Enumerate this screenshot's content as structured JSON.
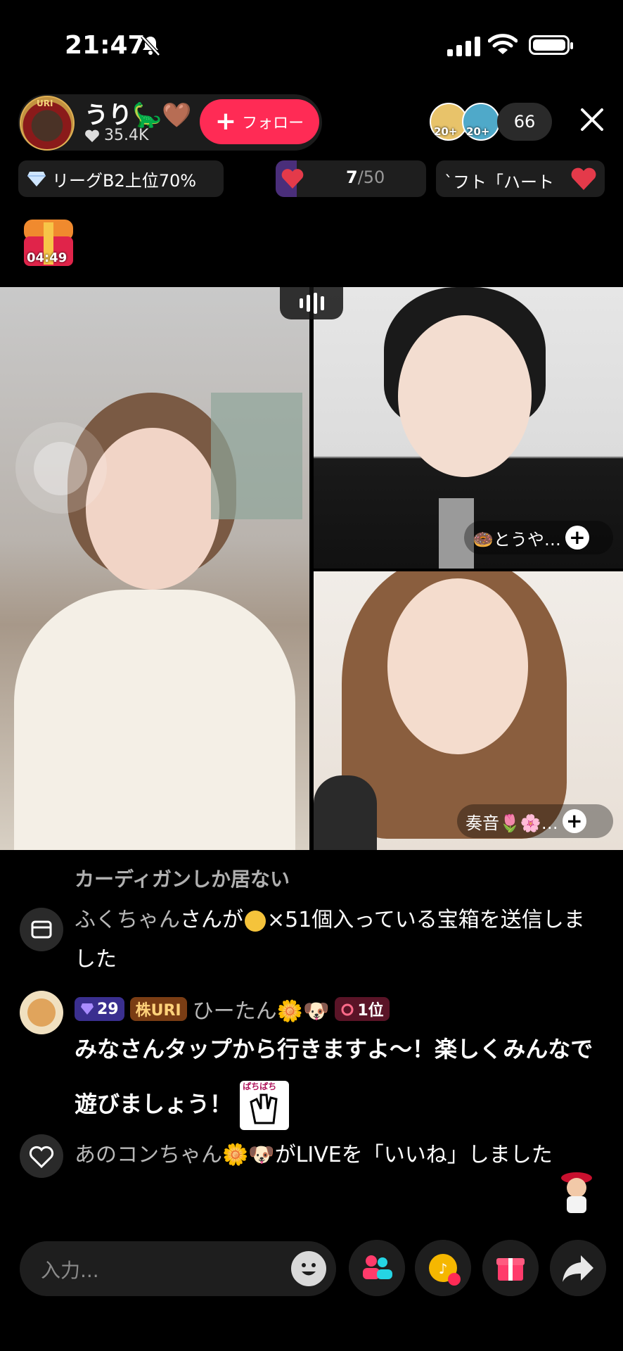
{
  "status_bar": {
    "time": "21:47"
  },
  "host": {
    "avatar_text": "URI",
    "name": "うり🦕🤎",
    "likes": "35.4K",
    "follow_label": "フォロー"
  },
  "viewers": {
    "badge_1": "20+",
    "badge_2": "20+",
    "count": "66"
  },
  "league": {
    "label": "リーグB2上位70%"
  },
  "goal": {
    "current": "7",
    "max": "/50",
    "progress": 0.14
  },
  "gift_ticker": {
    "text": "`フト「ハート"
  },
  "chest": {
    "timer": "04:49"
  },
  "guests": [
    {
      "name": "🍩とうや…"
    },
    {
      "name": "奏音🌷🌸…"
    }
  ],
  "chat": [
    {
      "text": "カーディガンしか居ない"
    },
    {
      "user": "ふくちゃん",
      "pre": "さんが",
      "mid": "×51個入っている宝箱を送信しました"
    },
    {
      "badge_level": "29",
      "badge_fan": "株URI",
      "user": "ひーたん🌼🐶",
      "rank": "1位",
      "text": "みなさんタップから行きますよ〜！楽しくみんなで遊びましょう！",
      "sticker_text": "ぱちぱち"
    },
    {
      "user": "あのコンちゃん🌼🐶",
      "text": "がLIVEを「いいね」しました"
    }
  ],
  "composer": {
    "placeholder": "入力..."
  },
  "colors": {
    "accent": "#ff2b55",
    "background": "#000000"
  }
}
